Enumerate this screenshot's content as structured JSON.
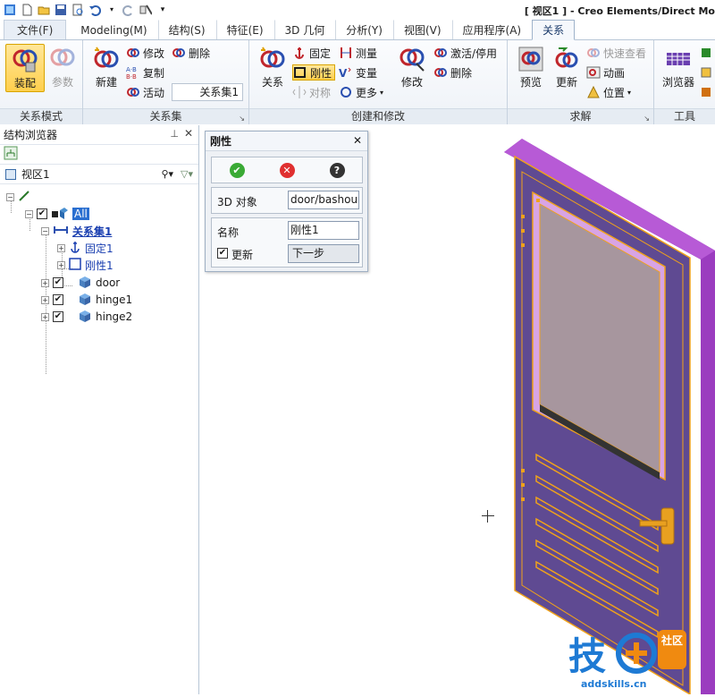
{
  "window": {
    "title": "[ 视区1 ] - Creo Elements/Direct Mo"
  },
  "quick_access": {
    "icons": [
      "app-icon",
      "new-icon",
      "open-icon",
      "save-icon",
      "print-preview-icon",
      "undo-icon",
      "dropdown-arrow-icon",
      "redo-icon",
      "tools-icon",
      "customize-icon"
    ]
  },
  "tabs": [
    {
      "label": "文件(F)",
      "active": false
    },
    {
      "label": "Modeling(M)",
      "active": false
    },
    {
      "label": "结构(S)",
      "active": false
    },
    {
      "label": "特征(E)",
      "active": false
    },
    {
      "label": "3D 几何",
      "active": false
    },
    {
      "label": "分析(Y)",
      "active": false
    },
    {
      "label": "视图(V)",
      "active": false
    },
    {
      "label": "应用程序(A)",
      "active": false
    },
    {
      "label": "关系",
      "active": true
    }
  ],
  "ribbon": {
    "groups": {
      "mode": "关系模式",
      "set": "关系集",
      "create": "创建和修改",
      "solve": "求解",
      "tools": "工具"
    },
    "mode": {
      "assemble": "装配",
      "param": "参数"
    },
    "set": {
      "new": "新建",
      "modify": "修改",
      "delete": "删除",
      "copy": "复制",
      "active": "活动",
      "combo_value": "关系集1"
    },
    "create": {
      "relation": "关系",
      "fix": "固定",
      "rigid": "刚性",
      "symmetric": "对称",
      "measure": "测量",
      "variable": "变量",
      "more": "更多",
      "modify": "修改",
      "activate": "激活/停用",
      "delete": "删除"
    },
    "solve": {
      "preview": "预览",
      "update": "更新",
      "quick_view": "快速查看",
      "animate": "动画",
      "position": "位置"
    },
    "tools": {
      "browser": "浏览器"
    }
  },
  "panel": {
    "title": "结构浏览器",
    "view_label": "视区1",
    "tree": {
      "root_all": "All",
      "relset": "关系集1",
      "fixed": "固定1",
      "rigid": "刚性1",
      "door": "door",
      "hinge1": "hinge1",
      "hinge2": "hinge2"
    }
  },
  "dialog": {
    "title": "刚性",
    "obj_label": "3D 对象",
    "obj_value": "door/bashou",
    "name_label": "名称",
    "name_value": "刚性1",
    "update_label": "更新",
    "update_checked": true,
    "next_label": "下一步"
  },
  "watermark": {
    "text": "addskills.cn",
    "badge": "社区"
  },
  "colors": {
    "accent": "#1e7ad4",
    "door_purple": "#7a2e93",
    "selection_orange": "#f0a21a",
    "ribbon_sel": "#ffcf4d"
  }
}
